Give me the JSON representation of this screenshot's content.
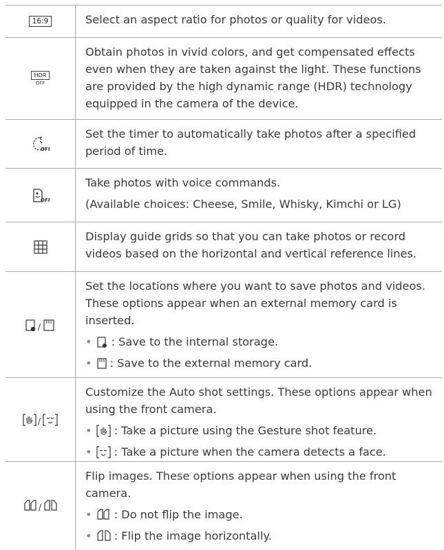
{
  "rows": [
    {
      "icon": "aspect-ratio-icon",
      "icon_text": "16:9",
      "lines": [
        "Select an aspect ratio for photos or quality for videos."
      ]
    },
    {
      "icon": "hdr-off-icon",
      "icon_text": "HDR",
      "icon_sub": "OFF",
      "lines": [
        "Obtain photos in vivid colors, and get compensated effects even when they are taken against the light. These functions are provided by the high dynamic range (HDR) technology equipped in the camera of the device."
      ]
    },
    {
      "icon": "timer-off-icon",
      "lines": [
        "Set the timer to automatically take photos after a specified period of time."
      ]
    },
    {
      "icon": "voice-shutter-off-icon",
      "lines": [
        "Take photos with voice commands.",
        "(Available choices: Cheese, Smile, Whisky, Kimchi or LG)"
      ]
    },
    {
      "icon": "grid-icon",
      "lines": [
        "Display guide grids so that you can take photos or record videos based on the horizontal and vertical reference lines."
      ]
    },
    {
      "icon": "storage-icon",
      "lines": [
        "Set the locations where you want to save photos and videos. These options appear when an external memory card is inserted."
      ],
      "bullets": [
        ": Save to the internal storage.",
        ": Save to the external memory card."
      ]
    },
    {
      "icon": "auto-shot-icon",
      "lines": [
        "Customize the Auto shot settings. These options appear when using the front camera."
      ],
      "bullets": [
        ": Take a picture using the Gesture shot feature.",
        ": Take a picture when the camera detects a face."
      ]
    },
    {
      "icon": "flip-icon",
      "lines": [
        "Flip images. These options appear when using the front camera."
      ],
      "bullets": [
        ": Do not flip the image.",
        ": Flip the image horizontally."
      ]
    }
  ]
}
